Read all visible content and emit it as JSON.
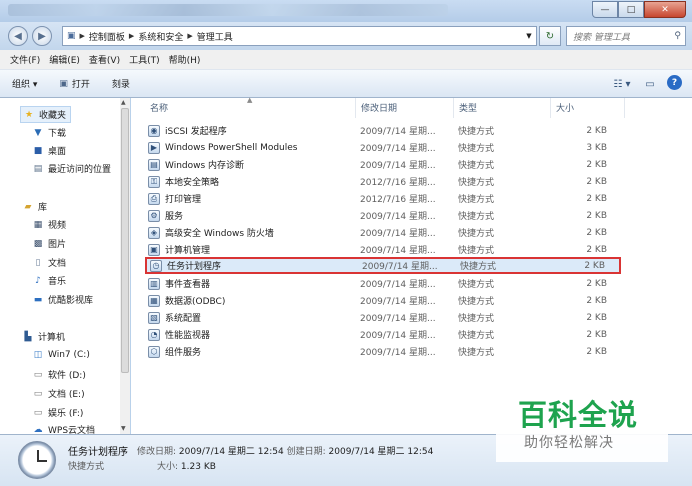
{
  "window": {
    "controls": {
      "minimize": "—",
      "maximize": "□",
      "close": "✕"
    }
  },
  "address": {
    "segments": [
      "控制面板",
      "系统和安全",
      "管理工具"
    ],
    "search_placeholder": "搜索 管理工具"
  },
  "menu": [
    "文件(F)",
    "编辑(E)",
    "查看(V)",
    "工具(T)",
    "帮助(H)"
  ],
  "toolbar": {
    "organize": "组织 ▾",
    "open": "打开",
    "burn": "刻录"
  },
  "nav": {
    "favorites": "收藏夹",
    "fav_items": [
      "下载",
      "桌面",
      "最近访问的位置"
    ],
    "libraries": "库",
    "lib_items": [
      "视频",
      "图片",
      "文档",
      "音乐",
      "优酷影视库"
    ],
    "computer": "计算机",
    "drives": [
      "Win7 (C:)",
      "软件 (D:)",
      "文档 (E:)",
      "娱乐 (F:)",
      "WPS云文档"
    ]
  },
  "columns": {
    "name": "名称",
    "date": "修改日期",
    "type": "类型",
    "size": "大小"
  },
  "files": [
    {
      "name": "iSCSI 发起程序",
      "date": "2009/7/14 星期...",
      "type": "快捷方式",
      "size": "2 KB",
      "icon": "iscsi-icon"
    },
    {
      "name": "Windows PowerShell Modules",
      "date": "2009/7/14 星期...",
      "type": "快捷方式",
      "size": "3 KB",
      "icon": "powershell-icon"
    },
    {
      "name": "Windows 内存诊断",
      "date": "2009/7/14 星期...",
      "type": "快捷方式",
      "size": "2 KB",
      "icon": "memory-diagnostic-icon"
    },
    {
      "name": "本地安全策略",
      "date": "2012/7/16 星期...",
      "type": "快捷方式",
      "size": "2 KB",
      "icon": "security-policy-icon"
    },
    {
      "name": "打印管理",
      "date": "2012/7/16 星期...",
      "type": "快捷方式",
      "size": "2 KB",
      "icon": "print-management-icon"
    },
    {
      "name": "服务",
      "date": "2009/7/14 星期...",
      "type": "快捷方式",
      "size": "2 KB",
      "icon": "services-icon"
    },
    {
      "name": "高级安全 Windows 防火墙",
      "date": "2009/7/14 星期...",
      "type": "快捷方式",
      "size": "2 KB",
      "icon": "firewall-icon"
    },
    {
      "name": "计算机管理",
      "date": "2009/7/14 星期...",
      "type": "快捷方式",
      "size": "2 KB",
      "icon": "computer-management-icon"
    },
    {
      "name": "任务计划程序",
      "date": "2009/7/14 星期...",
      "type": "快捷方式",
      "size": "2 KB",
      "icon": "task-scheduler-icon"
    },
    {
      "name": "事件查看器",
      "date": "2009/7/14 星期...",
      "type": "快捷方式",
      "size": "2 KB",
      "icon": "event-viewer-icon"
    },
    {
      "name": "数据源(ODBC)",
      "date": "2009/7/14 星期...",
      "type": "快捷方式",
      "size": "2 KB",
      "icon": "odbc-icon"
    },
    {
      "name": "系统配置",
      "date": "2009/7/14 星期...",
      "type": "快捷方式",
      "size": "2 KB",
      "icon": "system-config-icon"
    },
    {
      "name": "性能监视器",
      "date": "2009/7/14 星期...",
      "type": "快捷方式",
      "size": "2 KB",
      "icon": "performance-monitor-icon"
    },
    {
      "name": "组件服务",
      "date": "2009/7/14 星期...",
      "type": "快捷方式",
      "size": "2 KB",
      "icon": "component-services-icon"
    }
  ],
  "selected_index": 8,
  "status": {
    "name": "任务计划程序",
    "modified_label": "修改日期:",
    "modified_value": "2009/7/14 星期二 12:54",
    "created_label": "创建日期:",
    "created_value": "2009/7/14 星期二 12:54",
    "type": "快捷方式",
    "size_label": "大小:",
    "size_value": "1.23 KB"
  },
  "watermark": {
    "title": "百科全说",
    "subtitle": "助你轻松解决"
  }
}
